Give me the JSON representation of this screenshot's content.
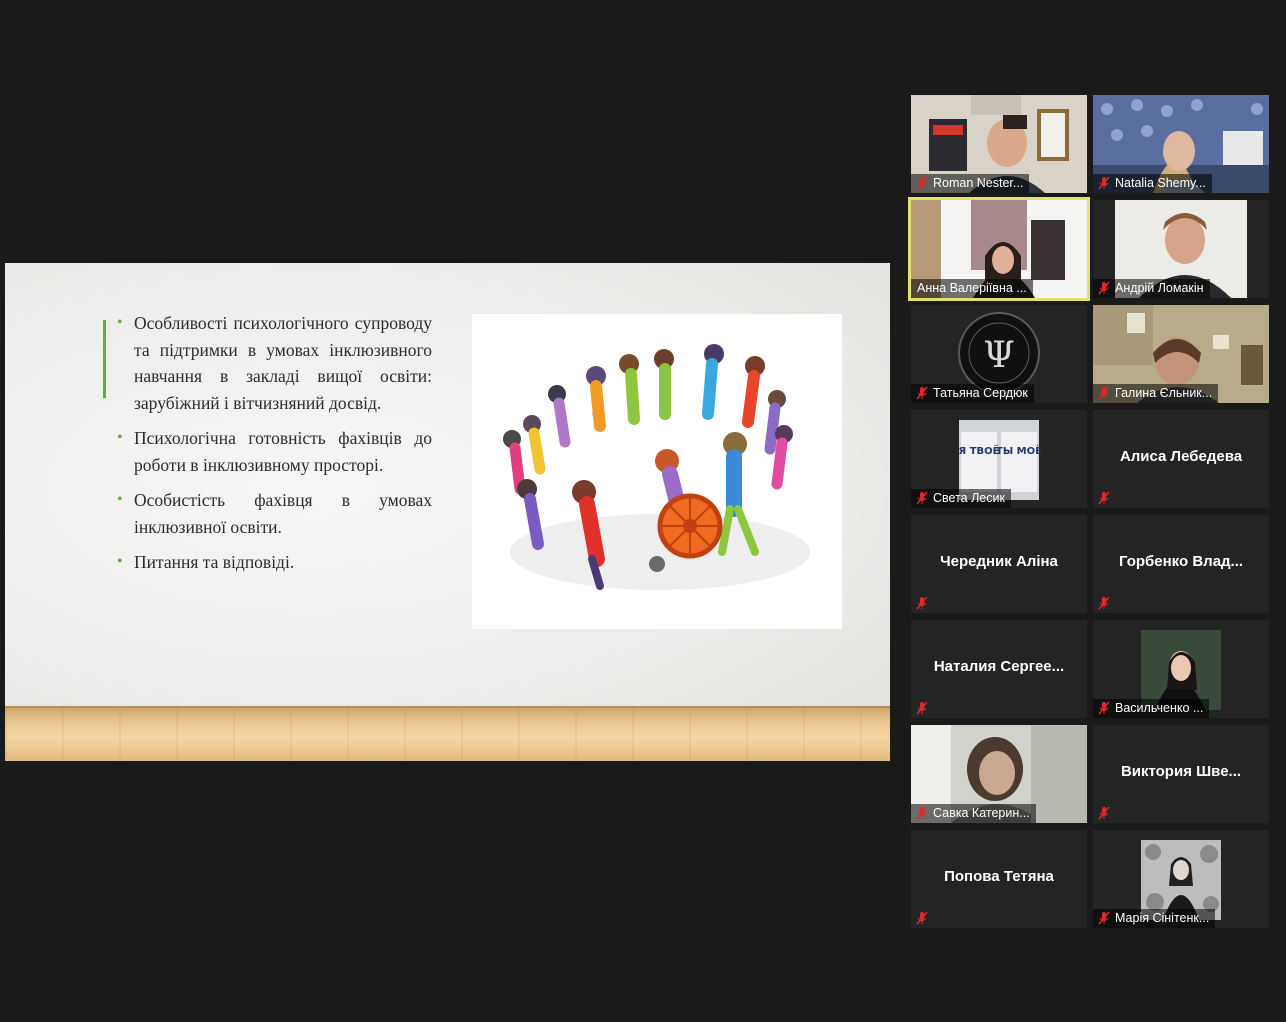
{
  "slide": {
    "bullets": [
      "Особливості психологічного супроводу та підтримки в умовах інклюзивного навчання в закладі вищої освіти: зарубіжний і вітчизняний досвід.",
      "Психологічна готовність фахівців до роботи в інклюзивному просторі.",
      "Особистість фахівця в умовах інклюзивної освіти.",
      "Питання та відповіді."
    ]
  },
  "participants": [
    {
      "name": "Roman Nester...",
      "video": true,
      "muted": true
    },
    {
      "name": "Natalia Shemy...",
      "video": true,
      "muted": true
    },
    {
      "name": "Анна Валеріївна ...",
      "video": true,
      "muted": false,
      "active": true
    },
    {
      "name": "Андрій Ломакін",
      "video": true,
      "muted": true
    },
    {
      "name": "Татьяна Сердюк",
      "video": true,
      "muted": true
    },
    {
      "name": "Галина Єльник...",
      "video": true,
      "muted": true
    },
    {
      "name": "Света Лесик",
      "video": true,
      "muted": true
    },
    {
      "name": "Алиса Лебедева",
      "video": false,
      "muted": true
    },
    {
      "name": "Чередник Аліна",
      "video": false,
      "muted": true
    },
    {
      "name": "Горбенко  Влад...",
      "video": false,
      "muted": true
    },
    {
      "name": "Наталия  Сергее...",
      "video": false,
      "muted": true
    },
    {
      "name": "Васильченко ...",
      "video": true,
      "muted": true
    },
    {
      "name": "Савка Катерин...",
      "video": true,
      "muted": true
    },
    {
      "name": "Виктория  Шве...",
      "video": false,
      "muted": true
    },
    {
      "name": "Попова Тетяна",
      "video": false,
      "muted": true
    },
    {
      "name": "Марія Сінітенк...",
      "video": true,
      "muted": true
    }
  ],
  "thumbnails": {
    "sveta_sign_left": "Я ТВОЁ",
    "sveta_sign_right": "ТЫ МОЁ"
  },
  "colors": {
    "background": "#1a1a1a",
    "tile": "#242424",
    "active_speaker": "#dfe36e",
    "mute_red": "#e02828",
    "bullet_accent": "#6aa84f"
  },
  "icons": [
    "mic-muted-icon"
  ]
}
